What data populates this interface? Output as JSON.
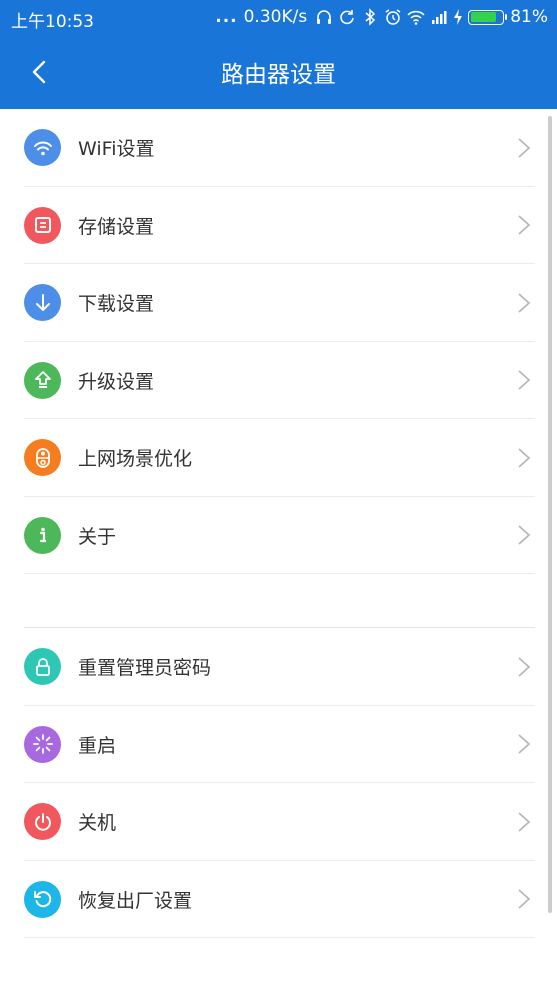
{
  "status_bar": {
    "time": "上午10:53",
    "dots": "...",
    "speed": "0.30K/s",
    "battery": "81%",
    "battery_level": 0.81,
    "icons": [
      "headphones-icon",
      "sync-icon",
      "bluetooth-icon",
      "alarm-icon",
      "wifi-icon",
      "signal-icon",
      "charging-icon",
      "battery-icon"
    ]
  },
  "header": {
    "title": "路由器设置",
    "back_icon": "chevron-left-icon"
  },
  "colors": {
    "primary": "#1976d8",
    "wifi": "#4d8fe8",
    "storage": "#f0585e",
    "download": "#4d8fe8",
    "upgrade": "#4cb85a",
    "scene": "#f57c1f",
    "about": "#4cb85a",
    "reset_password": "#2ec7b4",
    "restart": "#a868e0",
    "shutdown": "#f0585e",
    "factory_reset": "#1cb6e8"
  },
  "menu": {
    "group1": [
      {
        "label": "WiFi设置",
        "icon": "wifi-icon"
      },
      {
        "label": "存储设置",
        "icon": "storage-icon"
      },
      {
        "label": "下载设置",
        "icon": "download-icon"
      },
      {
        "label": "升级设置",
        "icon": "upgrade-icon"
      },
      {
        "label": "上网场景优化",
        "icon": "toggle-icon"
      },
      {
        "label": "关于",
        "icon": "info-icon"
      }
    ],
    "group2": [
      {
        "label": "重置管理员密码",
        "icon": "lock-icon"
      },
      {
        "label": "重启",
        "icon": "restart-icon"
      },
      {
        "label": "关机",
        "icon": "power-icon"
      },
      {
        "label": "恢复出厂设置",
        "icon": "reset-icon"
      }
    ]
  }
}
